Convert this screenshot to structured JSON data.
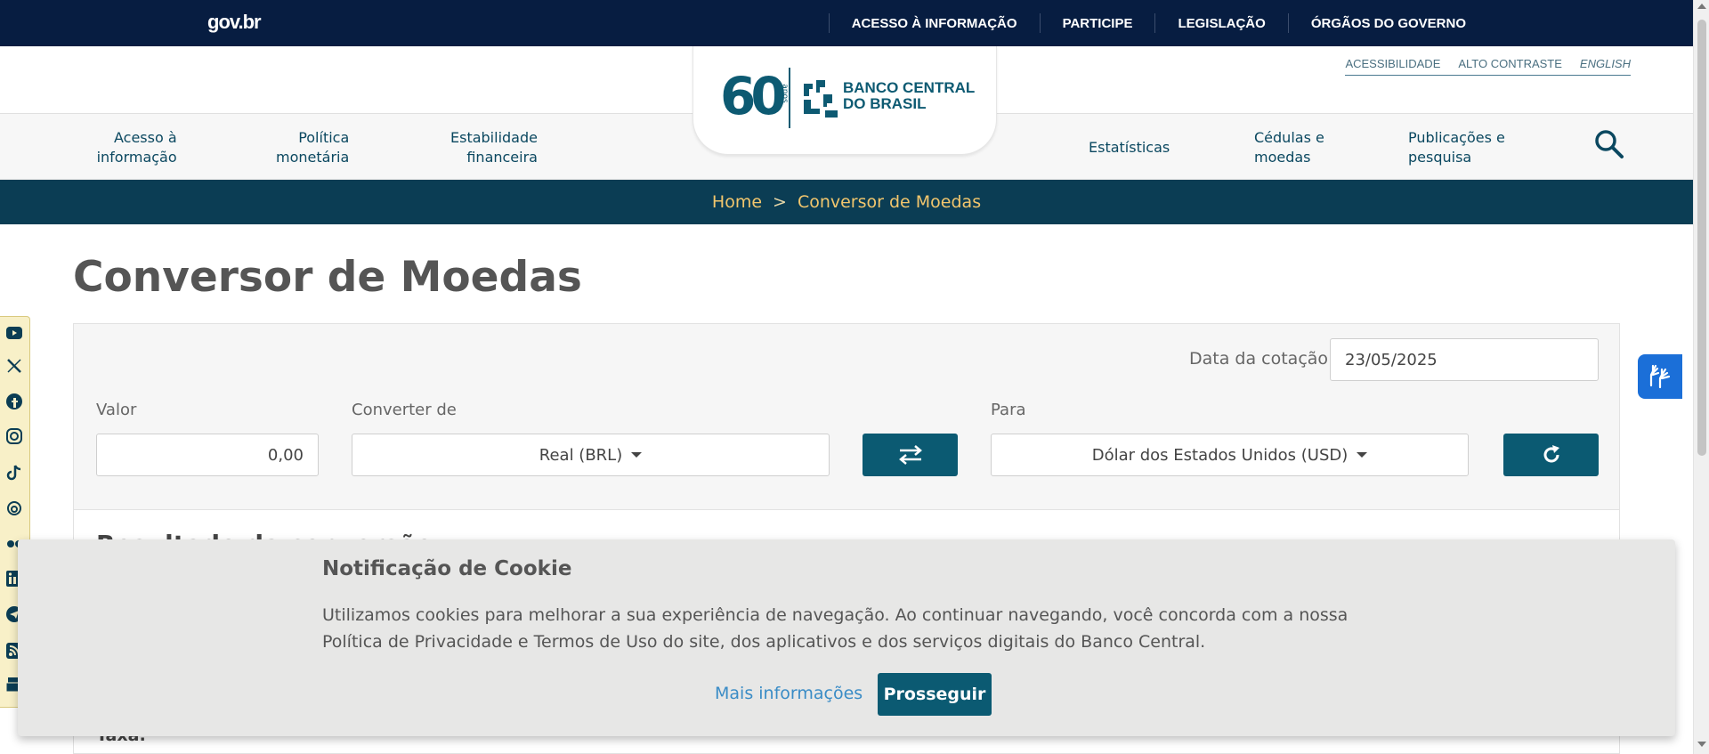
{
  "govbar": {
    "logo": "gov.br",
    "links": [
      "ACESSO À INFORMAÇÃO",
      "PARTICIPE",
      "LEGISLAÇÃO",
      "ÓRGÃOS DO GOVERNO"
    ]
  },
  "accessibility": {
    "links": [
      "ACESSIBILIDADE",
      "ALTO CONTRASTE",
      "ENGLISH"
    ]
  },
  "logo": {
    "anniversary": "60",
    "anos": "anos",
    "name_line1": "BANCO CENTRAL",
    "name_line2": "DO BRASIL"
  },
  "nav": {
    "left": [
      {
        "line1": "Acesso à",
        "line2": "informação"
      },
      {
        "line1": "Política",
        "line2": "monetária"
      },
      {
        "line1": "Estabilidade",
        "line2": "financeira"
      }
    ],
    "right": [
      {
        "line1": "Estatísticas",
        "line2": ""
      },
      {
        "line1": "Cédulas e",
        "line2": "moedas"
      },
      {
        "line1": "Publicações e",
        "line2": "pesquisa"
      }
    ],
    "search_icon": "search-icon"
  },
  "breadcrumb": {
    "home": "Home",
    "separator": ">",
    "current": "Conversor de Moedas"
  },
  "page": {
    "title": "Conversor de Moedas"
  },
  "converter": {
    "date_label": "Data da cotação",
    "date_value": "23/05/2025",
    "valor_label": "Valor",
    "valor_value": "0,00",
    "from_label": "Converter de",
    "from_value": "Real (BRL)",
    "to_label": "Para",
    "to_value": "Dólar dos Estados Unidos (USD)",
    "swap_icon": "swap-arrows-icon",
    "refresh_icon": "refresh-icon"
  },
  "result": {
    "title": "Resultado da conversão",
    "taxa_label": "Taxa:"
  },
  "social": [
    "youtube-icon",
    "x-icon",
    "facebook-icon",
    "instagram-icon",
    "tiktok-icon",
    "threads-icon",
    "flickr-icon",
    "linkedin-icon",
    "telegram-icon",
    "rss-icon",
    "newsletter-icon"
  ],
  "cookie": {
    "title": "Notificação de Cookie",
    "text": "Utilizamos cookies para melhorar a sua experiência de navegação. Ao continuar navegando, você concorda com a nossa Política de Privacidade e Termos de Uso do site, dos aplicativos e dos serviços digitais do Banco Central.",
    "more": "Mais informações",
    "accept": "Prosseguir"
  },
  "colors": {
    "govbar": "#071d41",
    "brand": "#0b5a72",
    "breadcrumb_bg": "#0b3d54",
    "breadcrumb_text": "#f2c66d",
    "vlibras": "#1b6fd8"
  }
}
